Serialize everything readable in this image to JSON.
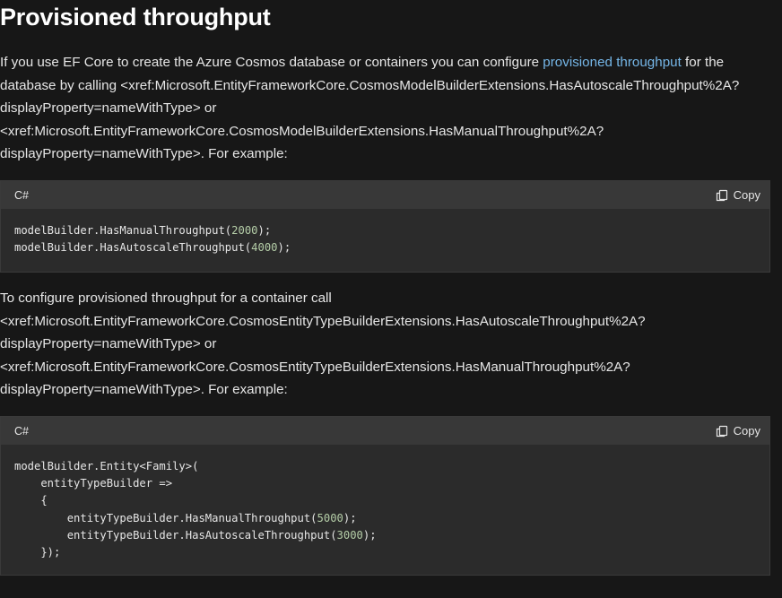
{
  "heading": "Provisioned throughput",
  "para1": {
    "line1_before": "If you use EF Core to create the Azure Cosmos database or containers you can configure ",
    "line1_link": "provisioned throughput",
    "line1_after": " for the",
    "line2": "database by calling <xref:Microsoft.EntityFrameworkCore.CosmosModelBuilderExtensions.HasAutoscaleThroughput%2A?",
    "line3": "displayProperty=nameWithType> or",
    "line4": "<xref:Microsoft.EntityFrameworkCore.CosmosModelBuilderExtensions.HasManualThroughput%2A?",
    "line5": "displayProperty=nameWithType>. For example:"
  },
  "code1": {
    "language": "C#",
    "copy_label": "Copy",
    "line1_pre": "modelBuilder.HasManualThroughput(",
    "line1_num": "2000",
    "line1_post": ");",
    "line2_pre": "modelBuilder.HasAutoscaleThroughput(",
    "line2_num": "4000",
    "line2_post": ");"
  },
  "para2": {
    "line1": "To configure provisioned throughput for a container call",
    "line2": "<xref:Microsoft.EntityFrameworkCore.CosmosEntityTypeBuilderExtensions.HasAutoscaleThroughput%2A?",
    "line3": "displayProperty=nameWithType> or",
    "line4": "<xref:Microsoft.EntityFrameworkCore.CosmosEntityTypeBuilderExtensions.HasManualThroughput%2A?",
    "line5": "displayProperty=nameWithType>. For example:"
  },
  "code2": {
    "language": "C#",
    "copy_label": "Copy",
    "line1": "modelBuilder.Entity<Family>(",
    "line2": "    entityTypeBuilder =>",
    "line3": "    {",
    "line4_pre": "        entityTypeBuilder.HasManualThroughput(",
    "line4_num": "5000",
    "line4_post": ");",
    "line5_pre": "        entityTypeBuilder.HasAutoscaleThroughput(",
    "line5_num": "3000",
    "line5_post": ");",
    "line6": "    });"
  },
  "colors": {
    "background": "#171717",
    "link": "#75b6e7",
    "code_background": "#2b2b2b",
    "code_header": "#383838",
    "number_literal": "#b5cea8"
  },
  "icons": {
    "copy": "copy-icon"
  }
}
